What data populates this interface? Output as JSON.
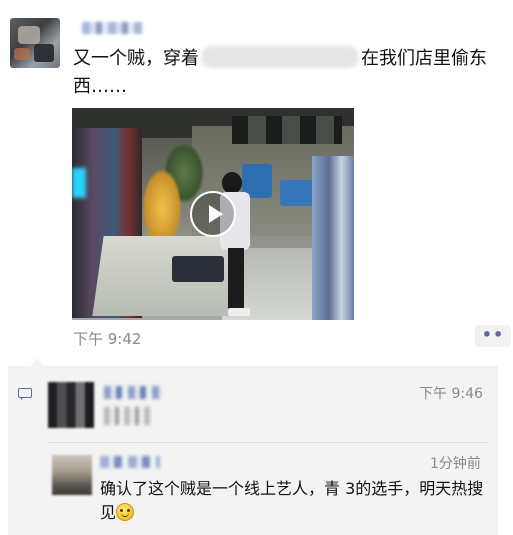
{
  "post": {
    "text_before": "又一个贼，穿着",
    "text_after": "在我们店里偷东西……",
    "time": "下午 9:42",
    "more_label": "••"
  },
  "comments": [
    {
      "time": "下午 9:46"
    },
    {
      "time": "1分钟前",
      "text": "确认了这个贼是一个线上艺人，青 3的选手，明天热搜见",
      "emoji": "smile-emoji"
    }
  ],
  "colors": {
    "link": "#5a6e9c",
    "panel_bg": "#f3f3f3",
    "meta_text": "#8a8a8a"
  }
}
